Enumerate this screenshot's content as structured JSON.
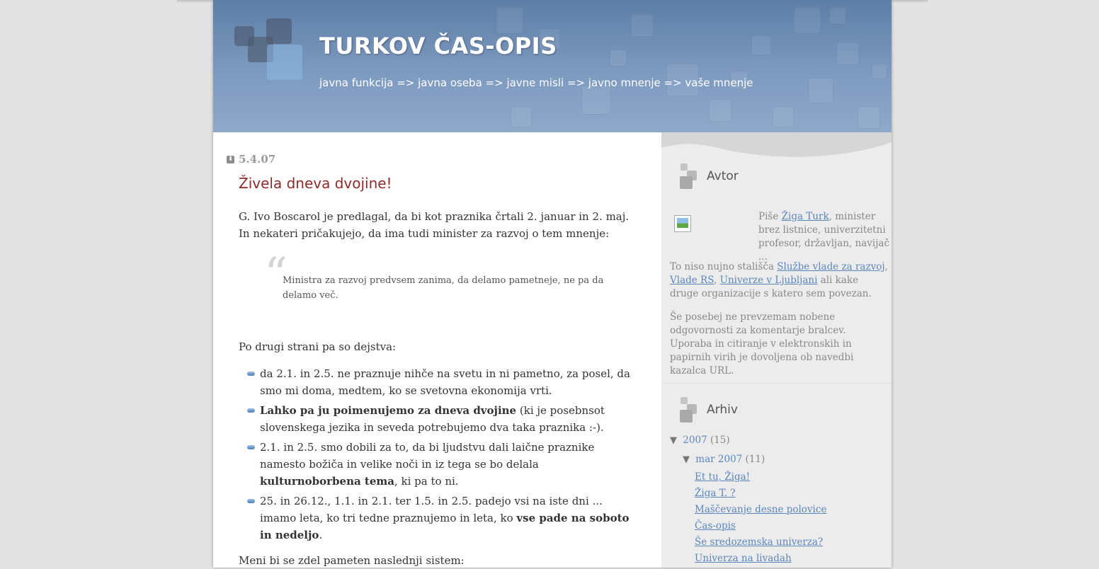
{
  "header": {
    "title": "TURKOV ČAS-OPIS",
    "description": "javna funkcija => javna oseba => javne misli => javno mnenje => vaše mnenje"
  },
  "post": {
    "date": "5.4.07",
    "title": "Živela dneva dvojine!",
    "intro": "G. Ivo Boscarol je predlagal, da bi kot praznika črtali 2. januar in 2. maj. In nekateri pričakujejo, da ima tudi minister za razvoj o tem mnenje:",
    "quote": "Ministra za razvoj predvsem zanima, da delamo pametneje, ne pa da delamo več.",
    "facts_intro": "Po drugi strani pa so dejstva:",
    "facts": [
      {
        "a": "da 2.1. in 2.5. ne praznuje nihče na svetu in ni pametno, za posel, da smo mi doma, medtem, ko se svetovna ekonomija vrti.",
        "b": "",
        "c": ""
      },
      {
        "a": "",
        "b": "Lahko pa ju poimenujemo za dneva dvojine",
        "c": " (ki je posebnsot slovenskega jezika in seveda potrebujemo dva taka praznika :-)."
      },
      {
        "a": "2.1. in 2.5. smo dobili za to, da bi ljudstvu dali laične praznike namesto božiča in velike noči in iz tega se bo delala ",
        "b": "kulturnoborbena tema",
        "c": ", ki pa to ni."
      },
      {
        "a": "25. in 26.12., 1.1. in 2.1. ter 1.5. in 2.5. padejo vsi na iste dni ... imamo leta, ko tri tedne praznujemo in leta, ko ",
        "b": "vse pade na soboto in nedeljo",
        "c": "."
      }
    ],
    "outro": "Meni bi se zdel pameten naslednji sistem:"
  },
  "sidebar": {
    "author": {
      "heading": "Avtor",
      "bio_prefix": "Piše ",
      "bio_link": "Žiga Turk",
      "bio_suffix": ", minister brez listnice, univerzitetni profesor, državljan, navijač ...",
      "disclaimer_prefix": "To niso nujno stališča ",
      "link1": "Službe vlade za razvoj",
      "sep1": ", ",
      "link2": "Vlade RS",
      "sep2": ", ",
      "link3": "Univerze v Ljubljani",
      "disclaimer_suffix": " ali kake druge organizacije s katero sem povezan.",
      "note": "Še posebej ne prevzemam nobene odgovornosti za komentarje bralcev. Uporaba in citiranje v elektronskih in papirnih virih je dovoljena ob navedbi kazalca URL."
    },
    "archive": {
      "heading": "Arhiv",
      "year": "2007",
      "year_count": "(15)",
      "month": "mar 2007",
      "month_count": "(11)",
      "posts": [
        "Et tu, Žiga!",
        "Žiga T. ?",
        "Maščevanje desne polovice",
        "Čas-opis",
        "Še sredozemska univerza?",
        "Univerza na livadah"
      ]
    }
  }
}
